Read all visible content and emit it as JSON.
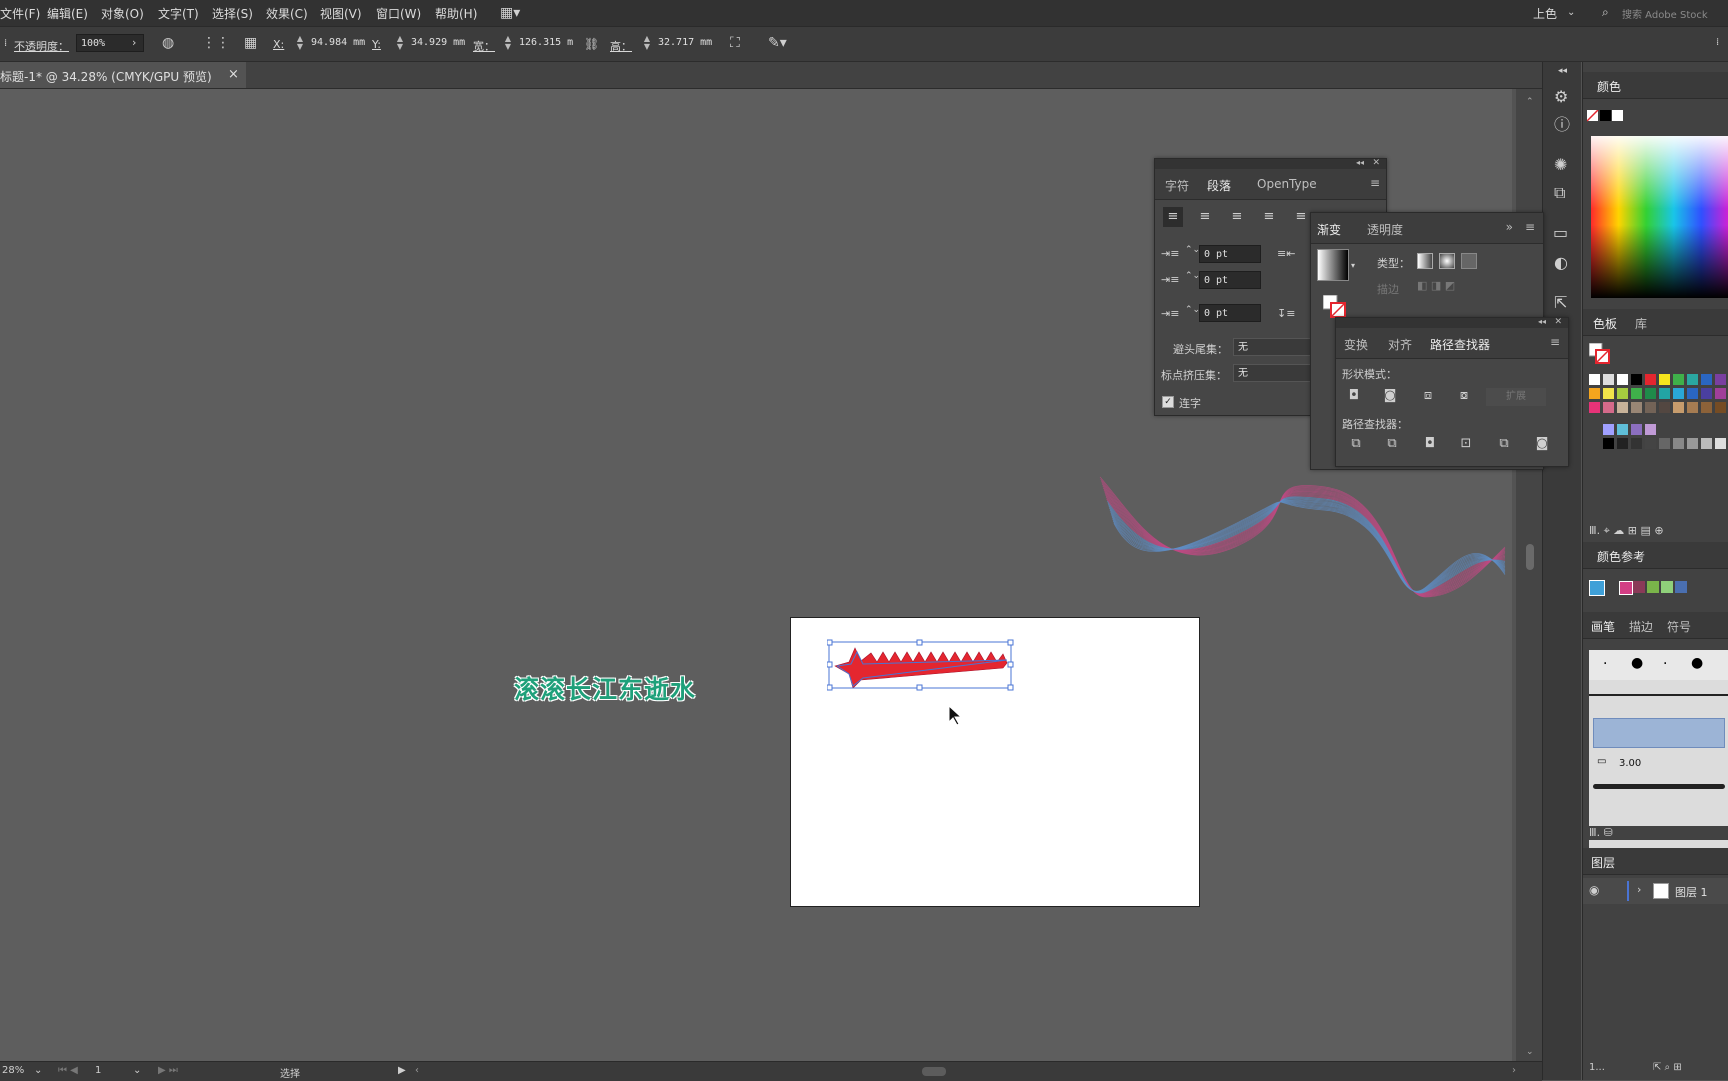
{
  "menu": {
    "items": [
      "文件(F)",
      "编辑(E)",
      "对象(O)",
      "文字(T)",
      "选择(S)",
      "效果(C)",
      "视图(V)",
      "窗口(W)",
      "帮助(H)"
    ],
    "workspace": "上色",
    "search_placeholder": "搜索 Adobe Stock"
  },
  "control": {
    "opacity_label": "不透明度：",
    "opacity_value": "100%",
    "x_label": "X:",
    "x_value": "94.984 mm",
    "y_label": "Y:",
    "y_value": "34.929 mm",
    "w_label": "宽：",
    "w_value": "126.315 m",
    "h_label": "高：",
    "h_value": "32.717 mm"
  },
  "document": {
    "tab_title": "标题-1* @ 34.28% (CMYK/GPU 预览)",
    "close_glyph": "×",
    "canvas_text": "滚滚长江东逝水",
    "text_color": "#1fa07a"
  },
  "status": {
    "zoom": "28%",
    "artboard": "1",
    "tool": "选择"
  },
  "paragraph_panel": {
    "tabs": [
      "字符",
      "段落",
      "OpenType"
    ],
    "indent_values": [
      "0 pt",
      "0 pt",
      "0 pt"
    ],
    "kinsoku_label": "避头尾集：",
    "kinsoku_value": "无",
    "mojikumi_label": "标点挤压集：",
    "mojikumi_value": "无",
    "hyphen_label": "连字"
  },
  "gradient_panel": {
    "tabs": [
      "渐变",
      "透明度"
    ],
    "type_label": "类型：",
    "stroke_label": "描边"
  },
  "pathfinder_panel": {
    "tabs": [
      "变换",
      "对齐",
      "路径查找器"
    ],
    "shape_modes_label": "形状模式：",
    "expand_label": "扩展",
    "pathfinders_label": "路径查找器："
  },
  "dock": {
    "color_title": "颜色",
    "swatches_tabs": [
      "色板",
      "库"
    ],
    "color_guide_title": "颜色参考",
    "brushes_tabs": [
      "画笔",
      "描边",
      "符号"
    ],
    "brush_size": "3.00",
    "layers_title": "图层",
    "layer_name": "图层 1",
    "layers_count": "1..."
  },
  "colors": {
    "accent_red": "#e4262f",
    "selection_blue": "#4a74d4",
    "wave_pink": "#c24a84",
    "wave_blue": "#5f8fc8"
  }
}
